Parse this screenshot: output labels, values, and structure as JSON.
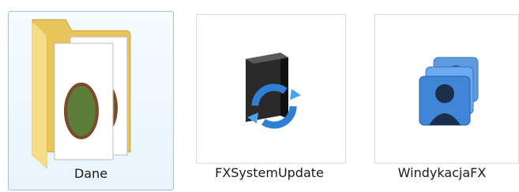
{
  "window": {
    "view_mode": "large-icons"
  },
  "items": [
    {
      "label": "Dane",
      "type": "folder",
      "icon": "folder-with-documents-icon",
      "selected": true
    },
    {
      "label": "FXSystemUpdate",
      "type": "shortcut",
      "icon": "system-update-icon",
      "selected": false
    },
    {
      "label": "WindykacjaFX",
      "type": "shortcut",
      "icon": "users-group-icon",
      "selected": false
    }
  ],
  "colors": {
    "selection_border": "#9fc4e6",
    "selection_fill": "#eaf4fc",
    "folder_yellow": "#f1cf63",
    "update_arrow_blue": "#3a8fe0",
    "users_blue": "#4a8fd4"
  }
}
